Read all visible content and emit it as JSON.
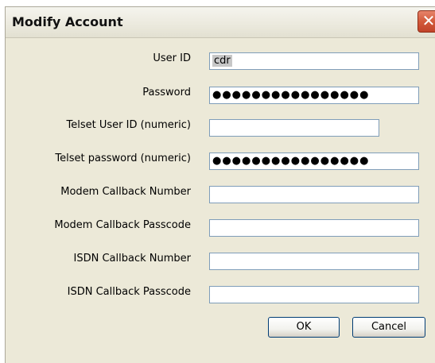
{
  "window": {
    "title": "Modify Account",
    "close_glyph": "✕"
  },
  "fields": [
    {
      "label": "User ID",
      "value": "cdr",
      "type": "text",
      "selected": true
    },
    {
      "label": "Password",
      "value": "●●●●●●●●●●●●●●●●",
      "type": "password"
    },
    {
      "label": "Telset User ID (numeric)",
      "value": "",
      "type": "text"
    },
    {
      "label": "Telset password (numeric)",
      "value": "●●●●●●●●●●●●●●●●",
      "type": "password"
    },
    {
      "label": "Modem Callback Number",
      "value": "",
      "type": "text"
    },
    {
      "label": "Modem Callback Passcode",
      "value": "",
      "type": "text"
    },
    {
      "label": "ISDN Callback Number",
      "value": "",
      "type": "text"
    },
    {
      "label": "ISDN Callback Passcode",
      "value": "",
      "type": "text"
    }
  ],
  "buttons": {
    "ok": "OK",
    "cancel": "Cancel"
  },
  "colors": {
    "dialog_bg": "#ece9d8",
    "field_border": "#7f9db9",
    "close_button": "#d35a3b"
  }
}
